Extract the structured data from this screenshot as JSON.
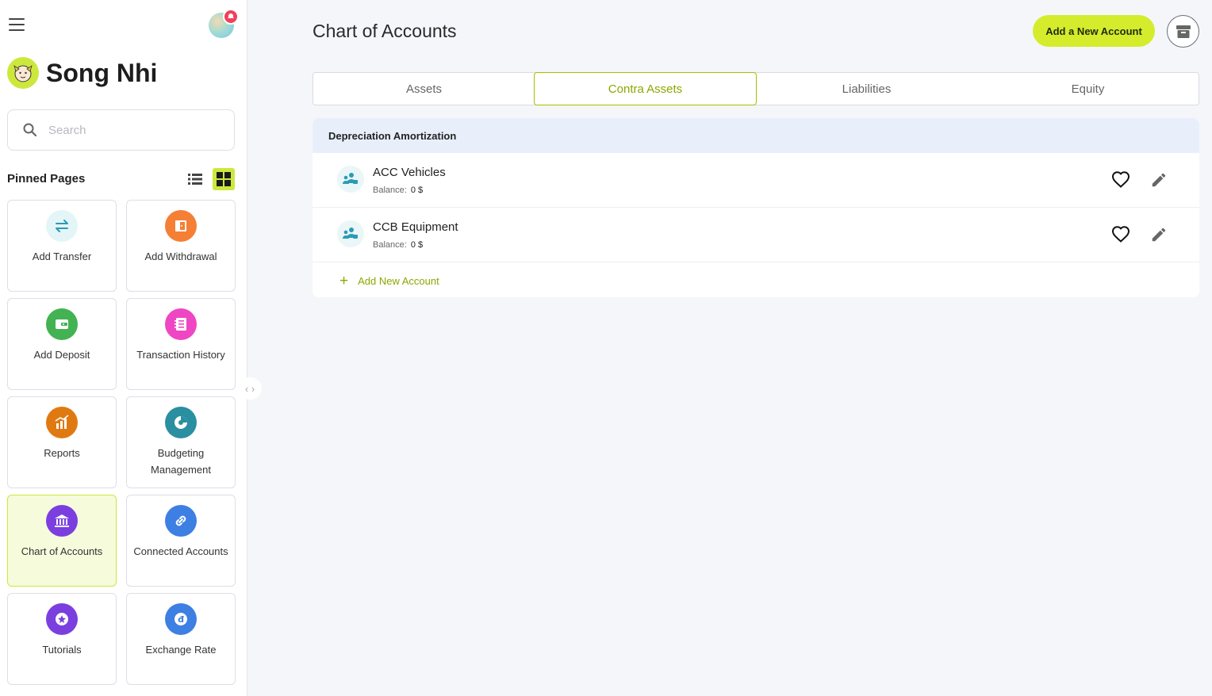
{
  "user": {
    "name": "Song Nhi"
  },
  "search": {
    "placeholder": "Search"
  },
  "sidebar": {
    "pinned_title": "Pinned Pages",
    "tiles": [
      {
        "label": "Add Transfer",
        "icon": "transfer-icon",
        "color": "#e4f5f8"
      },
      {
        "label": "Add Withdrawal",
        "icon": "withdrawal-icon",
        "color": "#f57f35"
      },
      {
        "label": "Add Deposit",
        "icon": "wallet-icon",
        "color": "#43b252"
      },
      {
        "label": "Transaction History",
        "icon": "history-icon",
        "color": "#ef47c3"
      },
      {
        "label": "Reports",
        "icon": "reports-icon",
        "color": "#e07a10"
      },
      {
        "label": "Budgeting Management",
        "icon": "budget-icon",
        "color": "#2a8fa0"
      },
      {
        "label": "Chart of Accounts",
        "icon": "bank-icon",
        "color": "#7b3fe0",
        "active": true
      },
      {
        "label": "Connected Accounts",
        "icon": "link-icon",
        "color": "#3d7fe3"
      },
      {
        "label": "Tutorials",
        "icon": "star-icon",
        "color": "#7b3fe0"
      },
      {
        "label": "Exchange Rate",
        "icon": "currency-icon",
        "color": "#3d7fe3"
      }
    ]
  },
  "page": {
    "title": "Chart of Accounts",
    "add_button": "Add a New Account"
  },
  "tabs": [
    {
      "label": "Assets",
      "active": false
    },
    {
      "label": "Contra Assets",
      "active": true
    },
    {
      "label": "Liabilities",
      "active": false
    },
    {
      "label": "Equity",
      "active": false
    }
  ],
  "group": {
    "title": "Depreciation Amortization",
    "accounts": [
      {
        "name": "ACC Vehicles",
        "balance_label": "Balance:",
        "balance": "0 $"
      },
      {
        "name": "CCB Equipment",
        "balance_label": "Balance:",
        "balance": "0 $"
      }
    ],
    "add_new_label": "Add New Account"
  },
  "colors": {
    "accent": "#d4ec2c",
    "accent_text": "#8ea600",
    "header_bg": "#e8effb"
  }
}
